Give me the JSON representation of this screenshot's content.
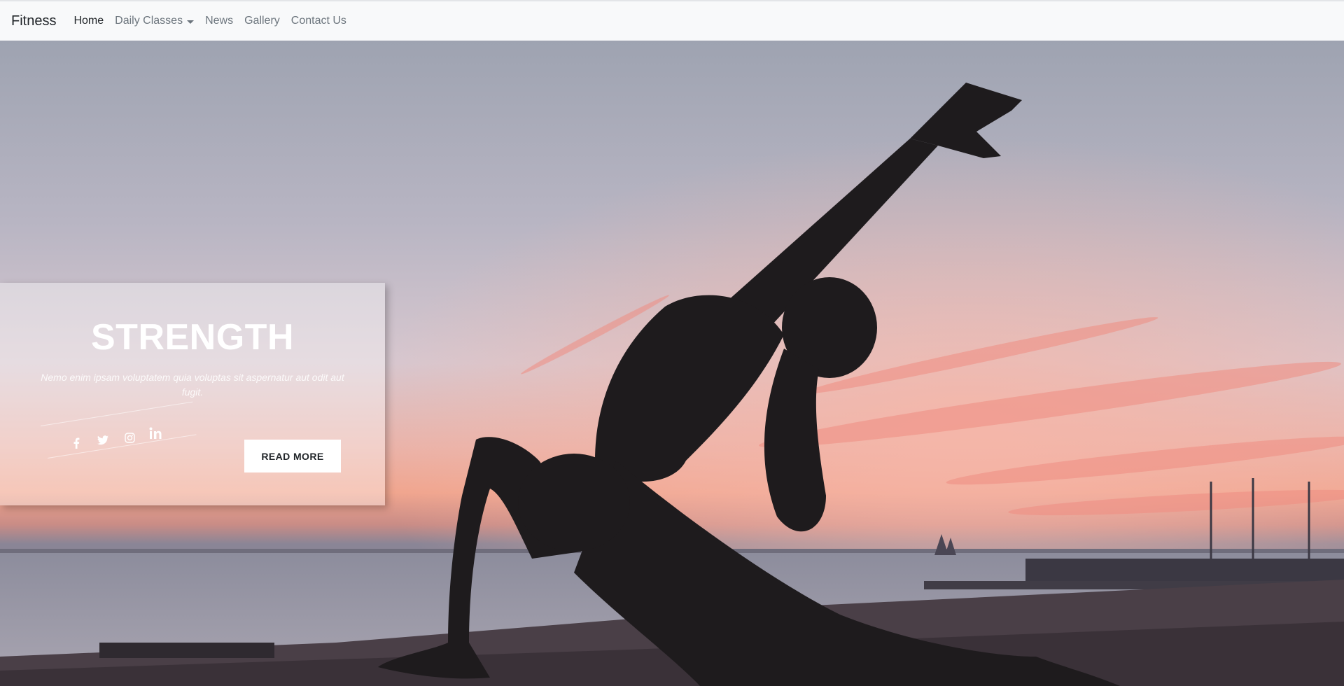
{
  "navbar": {
    "brand": "Fitness",
    "items": [
      {
        "label": "Home",
        "active": true
      },
      {
        "label": "Daily Classes",
        "dropdown": true
      },
      {
        "label": "News"
      },
      {
        "label": "Gallery"
      },
      {
        "label": "Contact Us"
      }
    ]
  },
  "hero": {
    "title": "STRENGTH",
    "text": "Nemo enim ipsam voluptatem quia voluptas sit aspernatur aut odit aut fugit.",
    "button_label": "READ MORE",
    "social_icons": [
      "facebook-icon",
      "twitter-icon",
      "instagram-icon",
      "linkedin-icon"
    ],
    "background": "silhouette of woman in yoga pose at sunset by the sea"
  },
  "colors": {
    "navbar_bg": "#f8f9fa",
    "nav_active": "#212529",
    "nav_muted": "#6c757d",
    "sky_top": "#9ea3b1",
    "sky_pink": "#f2a79f",
    "silhouette": "#1e1b1d"
  }
}
